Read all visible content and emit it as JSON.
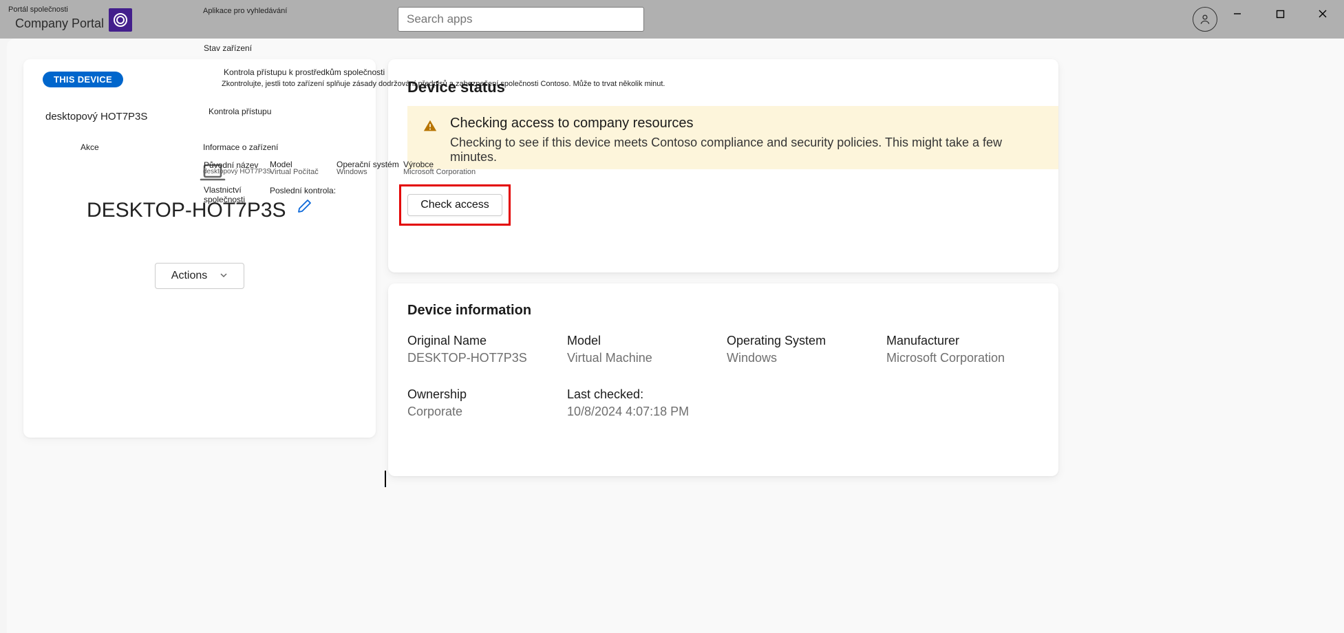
{
  "titlebar": {
    "app_label_small": "Portál společnosti",
    "app_title": "Company Portal",
    "search_label_small": "Aplikace pro vyhledávání",
    "search_placeholder": "Search apps"
  },
  "overlay": {
    "stav": "Stav zařízení",
    "kontrola_title": "Kontrola přístupu k prostředkům společnosti",
    "kontrola_desc": "Zkontrolujte, jestli toto zařízení splňuje zásady dodržování předpisů a zabezpečení společnosti Contoso. Může to trvat několik minut.",
    "kontrola_pristupu": "Kontrola přístupu",
    "akce": "Akce",
    "info": "Informace o zařízení",
    "puvodni": "Původní název",
    "puvodni_val": "desktopový HOT7P3S",
    "model": "Model",
    "model_val": "Virtual  Počítač",
    "os": "Operační systém",
    "os_val": "Windows",
    "vyrobce": "Výrobce",
    "vyrobce_val": "Microsoft Corporation",
    "vlast": "Vlastnictví",
    "vlast2": "společnosti",
    "posledni": "Poslední kontrola:"
  },
  "left": {
    "badge": "THIS DEVICE",
    "friendly": "desktopový HOT7P3S",
    "devname": "DESKTOP-HOT7P3S",
    "actions": "Actions"
  },
  "status": {
    "heading": "Device status",
    "notice_title": "Checking access to company resources",
    "notice_desc": "Checking to see if this device meets Contoso compliance and security policies. This might take a few minutes.",
    "check_button": "Check access"
  },
  "info": {
    "heading": "Device information",
    "original_name_label": "Original Name",
    "original_name_value": "DESKTOP-HOT7P3S",
    "model_label": "Model",
    "model_value": "Virtual Machine",
    "os_label": "Operating System",
    "os_value": "Windows",
    "manufacturer_label": "Manufacturer",
    "manufacturer_value": "Microsoft Corporation",
    "ownership_label": "Ownership",
    "ownership_value": "Corporate",
    "lastchecked_label": "Last checked:",
    "lastchecked_value": "10/8/2024 4:07:18 PM"
  }
}
